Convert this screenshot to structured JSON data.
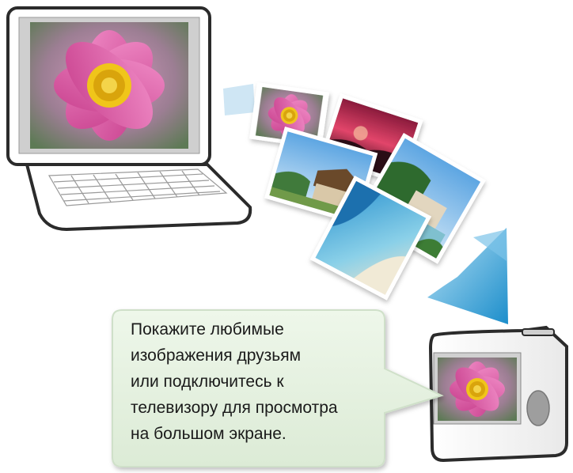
{
  "caption": {
    "lines": [
      "Покажите любимые",
      "изображения друзьям",
      "или подключитесь к",
      "телевизору для просмотра",
      "на большом экране."
    ]
  },
  "colors": {
    "callout_fill": "#e6f2e2",
    "callout_stroke": "#c9dcc4",
    "arrow_light": "#9fd3ee",
    "arrow_dark": "#1e8fc9",
    "device_outline": "#2b2b2b"
  },
  "icons": [
    "laptop-icon",
    "photo-stack-icon",
    "transfer-arrow-icon",
    "camera-icon",
    "flower-photo"
  ]
}
